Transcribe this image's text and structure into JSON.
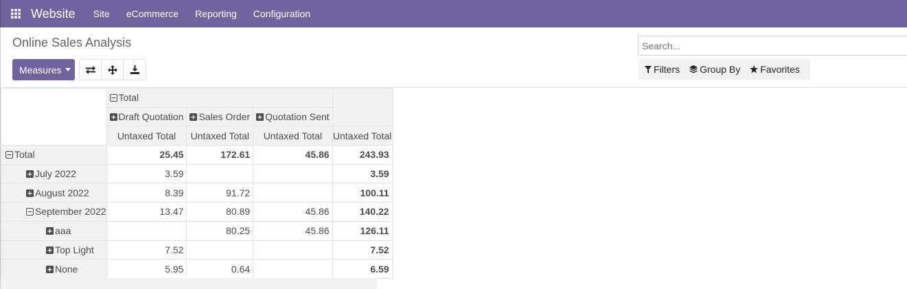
{
  "navbar": {
    "apps_icon": "grid-icon",
    "brand": "Website",
    "menu": [
      "Site",
      "eCommerce",
      "Reporting",
      "Configuration"
    ]
  },
  "control_panel": {
    "title": "Online Sales Analysis",
    "measures_label": "Measures",
    "icon_buttons": [
      "flip-axis-icon",
      "expand-all-icon",
      "download-icon"
    ],
    "search_placeholder": "Search...",
    "filters_label": "Filters",
    "groupby_label": "Group By",
    "favorites_label": "Favorites"
  },
  "pivot": {
    "col_total_label": "Total",
    "col_groups": [
      "Draft Quotation",
      "Sales Order",
      "Quotation Sent"
    ],
    "measure": "Untaxed Total",
    "rows": [
      {
        "label": "Total",
        "level": 0,
        "expanded": true,
        "values": [
          "25.45",
          "172.61",
          "45.86",
          "243.93"
        ],
        "bold": true
      },
      {
        "label": "July 2022",
        "level": 1,
        "expanded": false,
        "values": [
          "3.59",
          "",
          "",
          "3.59"
        ]
      },
      {
        "label": "August 2022",
        "level": 1,
        "expanded": false,
        "values": [
          "8.39",
          "91.72",
          "",
          "100.11"
        ]
      },
      {
        "label": "September 2022",
        "level": 1,
        "expanded": true,
        "values": [
          "13.47",
          "80.89",
          "45.86",
          "140.22"
        ]
      },
      {
        "label": "aaa",
        "level": 2,
        "expanded": false,
        "values": [
          "",
          "80.25",
          "45.86",
          "126.11"
        ]
      },
      {
        "label": "Top Light",
        "level": 2,
        "expanded": false,
        "values": [
          "7.52",
          "",
          "",
          "7.52"
        ]
      },
      {
        "label": "None",
        "level": 2,
        "expanded": false,
        "values": [
          "5.95",
          "0.64",
          "",
          "6.59"
        ]
      }
    ]
  },
  "colors": {
    "navbar": "#71639e",
    "header_bg": "#f2f2f2"
  }
}
